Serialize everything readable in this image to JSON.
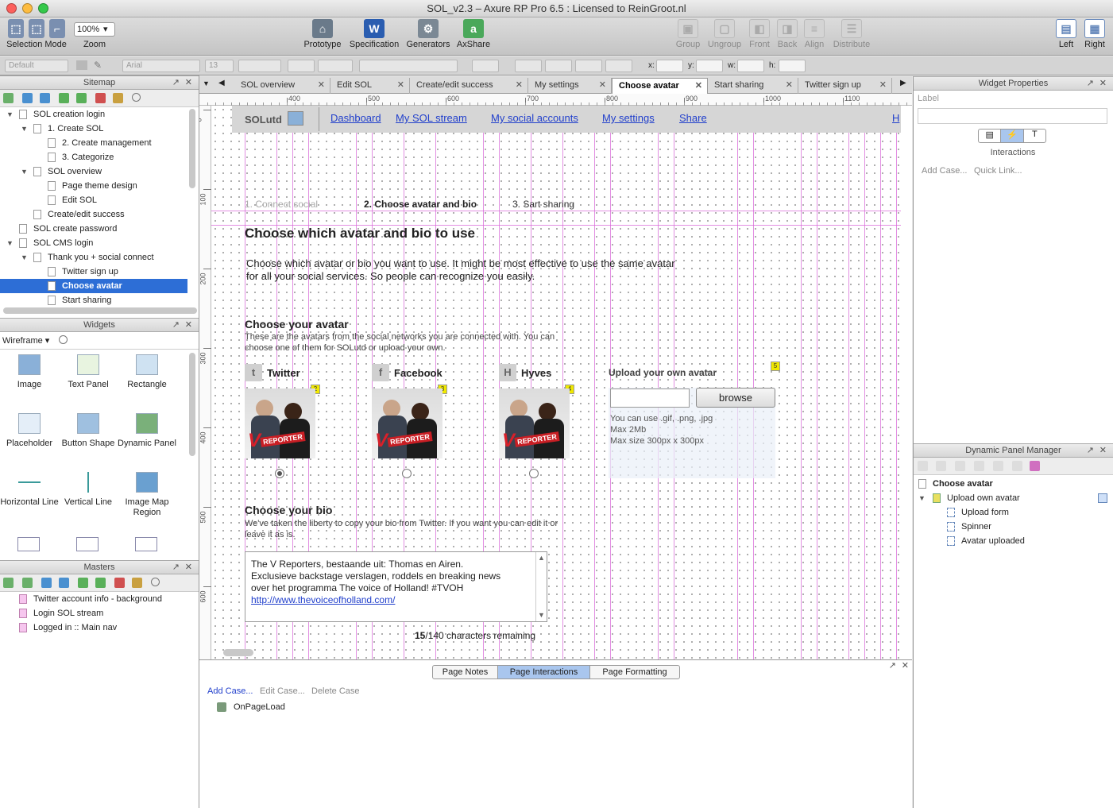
{
  "window": {
    "title": "SOL_v2.3 – Axure RP Pro 6.5 : Licensed to ReinGroot.nl"
  },
  "toolbar": {
    "selection_mode": "Selection Mode",
    "zoom_label": "Zoom",
    "zoom_value": "100%",
    "prototype": "Prototype",
    "specification": "Specification",
    "generators": "Generators",
    "axshare": "AxShare",
    "group": "Group",
    "ungroup": "Ungroup",
    "front": "Front",
    "back": "Back",
    "align": "Align",
    "distribute": "Distribute",
    "left": "Left",
    "right": "Right"
  },
  "format": {
    "style": "Default",
    "font": "Arial",
    "size": "13",
    "x": "x:",
    "y": "y:",
    "w": "w:",
    "h": "h:"
  },
  "sitemap": {
    "title": "Sitemap",
    "items": [
      {
        "label": "SOL creation login"
      },
      {
        "label": "1. Create SOL"
      },
      {
        "label": "2. Create management"
      },
      {
        "label": "3. Categorize"
      },
      {
        "label": "SOL overview"
      },
      {
        "label": "Page theme design"
      },
      {
        "label": "Edit SOL"
      },
      {
        "label": "Create/edit success"
      },
      {
        "label": "SOL create password"
      },
      {
        "label": "SOL CMS login"
      },
      {
        "label": "Thank you + social connect"
      },
      {
        "label": "Twitter sign up"
      },
      {
        "label": "Choose avatar"
      },
      {
        "label": "Start sharing"
      }
    ]
  },
  "widgets": {
    "title": "Widgets",
    "library": "Wireframe",
    "items": [
      {
        "label": "Image"
      },
      {
        "label": "Text Panel"
      },
      {
        "label": "Rectangle"
      },
      {
        "label": "Placeholder"
      },
      {
        "label": "Button Shape"
      },
      {
        "label": "Dynamic Panel"
      },
      {
        "label": "Horizontal Line"
      },
      {
        "label": "Vertical Line"
      },
      {
        "label": "Image Map Region"
      }
    ]
  },
  "masters": {
    "title": "Masters",
    "items": [
      {
        "label": "Twitter account info - background"
      },
      {
        "label": "Login SOL stream"
      },
      {
        "label": "Logged in :: Main nav"
      }
    ]
  },
  "tabs": [
    {
      "label": "SOL overview"
    },
    {
      "label": "Edit SOL"
    },
    {
      "label": "Create/edit success"
    },
    {
      "label": "My settings"
    },
    {
      "label": "Choose avatar"
    },
    {
      "label": "Start sharing"
    },
    {
      "label": "Twitter sign up"
    }
  ],
  "ruler": {
    "h": [
      "400",
      "500",
      "600",
      "700",
      "800",
      "900",
      "1000",
      "1100"
    ],
    "v": [
      "0",
      "100",
      "200",
      "300",
      "400",
      "500",
      "600"
    ]
  },
  "page": {
    "brand": "SOLutd",
    "nav": [
      "Dashboard",
      "My SOL stream",
      "My social accounts",
      "My settings",
      "Share",
      "H"
    ],
    "steps": [
      "1. Connect social",
      "2. Choose avatar and bio",
      "3. Sart sharing"
    ],
    "heading": "Choose which avatar and bio to use",
    "intro1": "Choose which avatar or bio you want to use. It might be most effective to use the same avatar",
    "intro2": "for all your social services. So people can recognize you easily.",
    "avatar_heading": "Choose your avatar",
    "avatar_desc1": "These are the avatars from the social networks you are connected with. You can",
    "avatar_desc2": "choose one of them for SOLutd or upload your own.",
    "networks": [
      {
        "name": "Twitter",
        "icon": "t",
        "badge": "2"
      },
      {
        "name": "Facebook",
        "icon": "f",
        "badge": "3"
      },
      {
        "name": "Hyves",
        "icon": "H",
        "badge": "4"
      }
    ],
    "avatar_caption": "REPORTER",
    "upload_heading": "Upload your own avatar",
    "upload_badge": "5",
    "browse": "browse",
    "upload_note1": "You can use .gif, .png, .jpg",
    "upload_note2": "Max 2Mb",
    "upload_note3": "Max size 300px x 300px",
    "bio_heading": "Choose your bio",
    "bio_desc1": "We've taken the liberty to copy your bio from Twitter. If you want you can edit it or",
    "bio_desc2": "leave it as is.",
    "bio1": "The V Reporters, bestaande uit: Thomas en Airen.",
    "bio2": "Exclusieve backstage verslagen, roddels en breaking news",
    "bio3": "over het programma The voice of Holland! #TVOH",
    "bio_link": "http://www.thevoiceofholland.com/",
    "chars_count": "15",
    "chars_rest": "/140 characters remaining"
  },
  "bottom": {
    "tabs": [
      "Page Notes",
      "Page Interactions",
      "Page Formatting"
    ],
    "add_case": "Add Case...",
    "edit_case": "Edit Case...",
    "delete_case": "Delete Case",
    "event": "OnPageLoad"
  },
  "widget_props": {
    "title": "Widget Properties",
    "label": "Label",
    "interactions": "Interactions",
    "add_case": "Add Case...",
    "quick_link": "Quick Link..."
  },
  "dpm": {
    "title": "Dynamic Panel Manager",
    "items": [
      {
        "label": "Choose avatar"
      },
      {
        "label": "Upload own avatar"
      },
      {
        "label": "Upload form"
      },
      {
        "label": "Spinner"
      },
      {
        "label": "Avatar uploaded"
      }
    ]
  },
  "colors": {
    "selection": "#2d6ed6",
    "link": "#2240cc",
    "guide": "#d86ad8",
    "badge": "#f0e800"
  }
}
